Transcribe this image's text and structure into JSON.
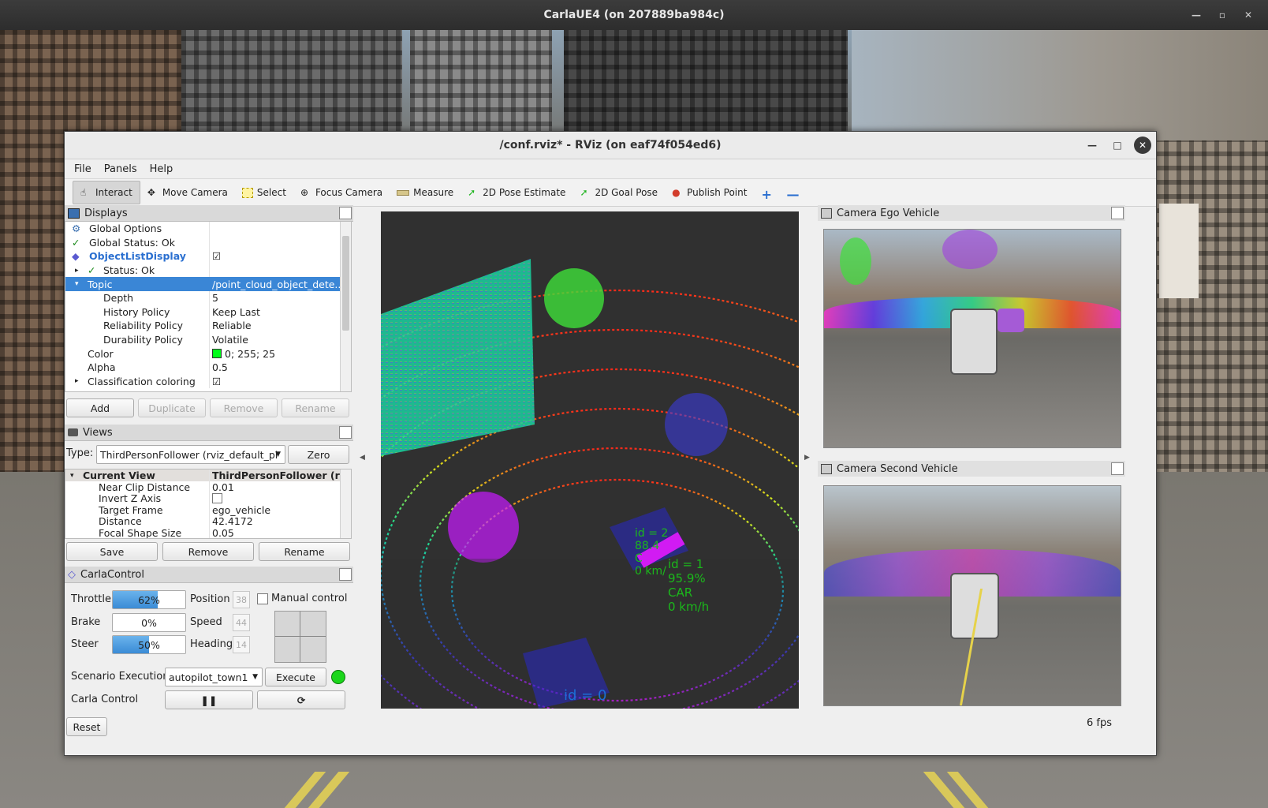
{
  "outer_window": {
    "title": "CarlaUE4   (on 207889ba984c)"
  },
  "rviz": {
    "title": "/conf.rviz* - RViz (on eaf74f054ed6)",
    "menu": [
      "File",
      "Panels",
      "Help"
    ],
    "toolbar": [
      "Interact",
      "Move Camera",
      "Select",
      "Focus Camera",
      "Measure",
      "2D Pose Estimate",
      "2D Goal Pose",
      "Publish Point"
    ],
    "displays": {
      "title": "Displays",
      "rows": [
        {
          "label": "Global Options",
          "value": ""
        },
        {
          "label": "Global Status: Ok",
          "value": ""
        },
        {
          "label": "ObjectListDisplay",
          "value": "☑"
        },
        {
          "label": "Status: Ok",
          "value": ""
        },
        {
          "label": "Topic",
          "value": "/point_cloud_object_dete..."
        },
        {
          "label": "Depth",
          "value": "5"
        },
        {
          "label": "History Policy",
          "value": "Keep Last"
        },
        {
          "label": "Reliability Policy",
          "value": "Reliable"
        },
        {
          "label": "Durability Policy",
          "value": "Volatile"
        },
        {
          "label": "Color",
          "value": "0; 255; 25"
        },
        {
          "label": "Alpha",
          "value": "0.5"
        },
        {
          "label": "Classification coloring",
          "value": "☑"
        }
      ],
      "buttons": [
        "Add",
        "Duplicate",
        "Remove",
        "Rename"
      ]
    },
    "views": {
      "title": "Views",
      "type_label": "Type:",
      "type_value": "ThirdPersonFollower (rviz_default_pl",
      "zero": "Zero",
      "header": {
        "label": "Current View",
        "value": "ThirdPersonFollower (rvi..."
      },
      "rows": [
        {
          "label": "Near Clip Distance",
          "value": "0.01"
        },
        {
          "label": "Invert Z Axis",
          "value": ""
        },
        {
          "label": "Target Frame",
          "value": "ego_vehicle"
        },
        {
          "label": "Distance",
          "value": "42.4172"
        },
        {
          "label": "Focal Shape Size",
          "value": "0.05"
        }
      ],
      "buttons": [
        "Save",
        "Remove",
        "Rename"
      ]
    },
    "carla_control": {
      "title": "CarlaControl",
      "throttle_label": "Throttle",
      "throttle": "62%",
      "throttle_fraction": 0.62,
      "brake_label": "Brake",
      "brake": "0%",
      "brake_fraction": 0.0,
      "steer_label": "Steer",
      "steer": "50%",
      "steer_fraction": 0.5,
      "position_label": "Position",
      "position": "38",
      "speed_label": "Speed",
      "speed": "44",
      "heading_label": "Heading",
      "heading": "14",
      "manual_control": "Manual control",
      "scenario_label": "Scenario Execution",
      "scenario_value": "autopilot_town1",
      "execute": "Execute",
      "status_color": "#1bd61b",
      "carla_control_label": "Carla Control",
      "pause_icon": "pause-icon",
      "step_icon": "step-icon"
    },
    "viewport_labels": [
      {
        "id_line": "id  =  2",
        "conf": "88.4",
        "cls": "C",
        "speed": "0  km/"
      },
      {
        "id_line": "id  =  1",
        "conf": "95.9%",
        "cls": "CAR",
        "speed": "0  km/h"
      },
      {
        "id_line": "id  =  0",
        "conf": "",
        "cls": "",
        "speed": ""
      }
    ],
    "camera_ego": {
      "title": "Camera Ego Vehicle"
    },
    "camera_second": {
      "title": "Camera Second Vehicle"
    },
    "reset": "Reset",
    "fps": "6 fps"
  }
}
